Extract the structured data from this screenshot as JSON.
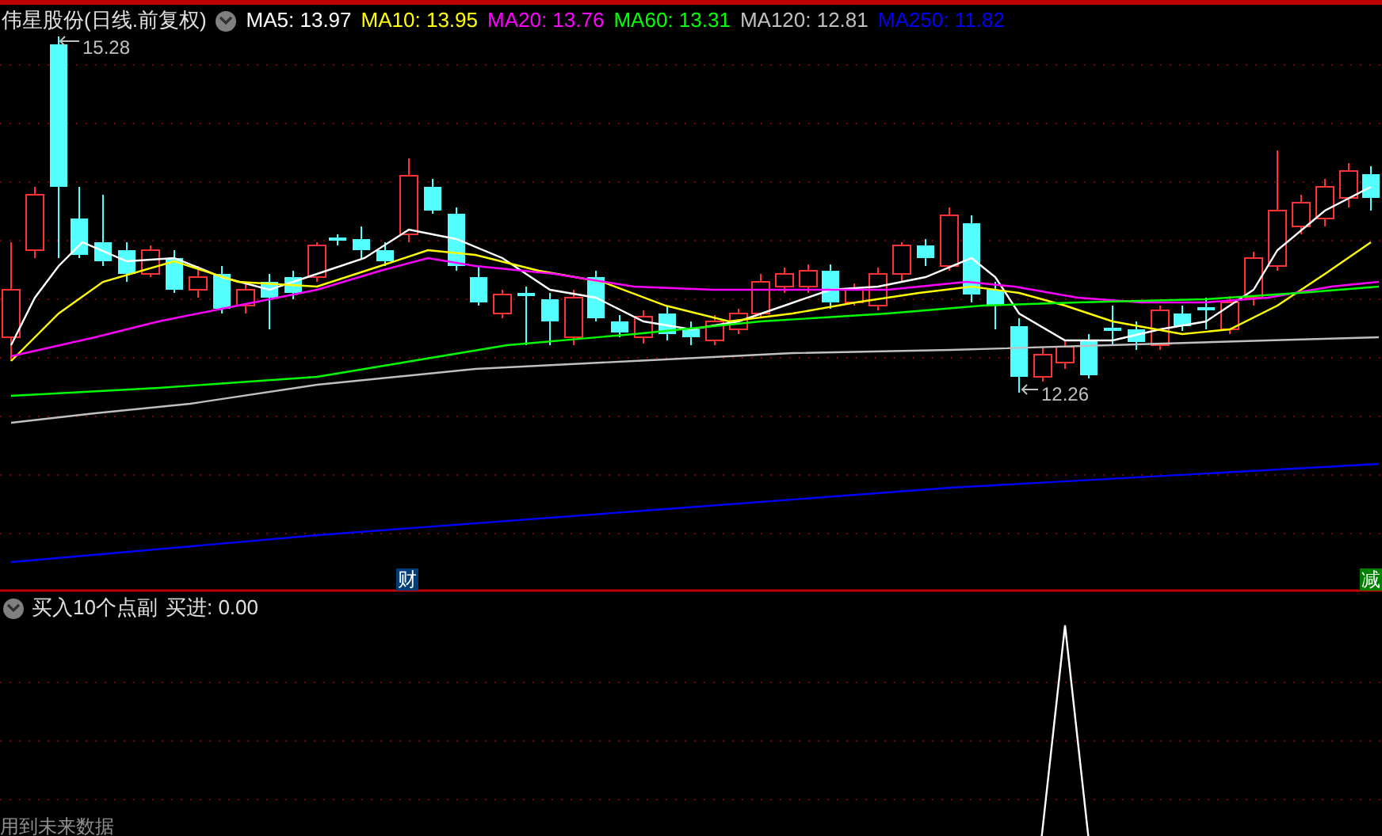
{
  "main_chart": {
    "title": "伟星股份(日线.前复权)",
    "moving_averages": [
      {
        "label": "MA5:",
        "value": "13.97",
        "color": "#ffffff"
      },
      {
        "label": "MA10:",
        "value": "13.95",
        "color": "#ffff00"
      },
      {
        "label": "MA20:",
        "value": "13.76",
        "color": "#ff00ff"
      },
      {
        "label": "MA60:",
        "value": "13.31",
        "color": "#00ff00"
      },
      {
        "label": "MA120:",
        "value": "12.81",
        "color": "#c0c0c0"
      },
      {
        "label": "MA250:",
        "value": "11.82",
        "color": "#0000ff"
      }
    ],
    "high_marker": "15.28",
    "low_marker": "12.26",
    "event_badges": [
      {
        "text": "财",
        "color": "#003c78"
      },
      {
        "text": "减",
        "color": "#008000"
      }
    ]
  },
  "indicator_panel": {
    "title": "买入10个点副",
    "readout": "买进: 0.00",
    "warning": "用到未来数据"
  }
}
